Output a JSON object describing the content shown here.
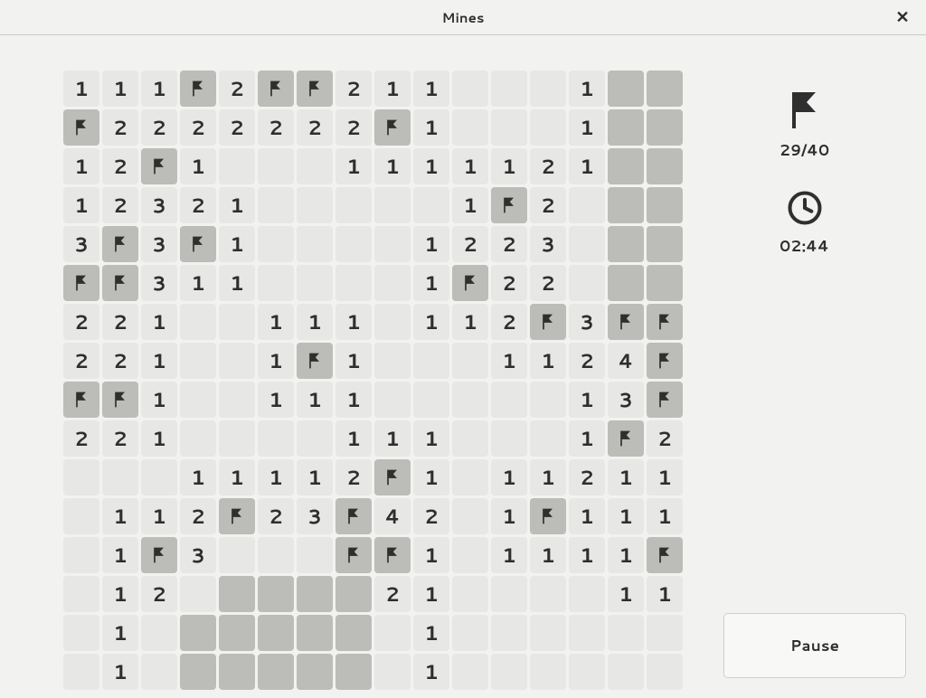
{
  "window": {
    "title": "Mines",
    "close_label": "✕"
  },
  "status": {
    "flags_placed": 29,
    "total_mines": 40,
    "flags_text": "29/40",
    "elapsed_time": "02:44"
  },
  "controls": {
    "pause_label": "Pause"
  },
  "legend": {
    ".": "revealed-empty",
    "#": "hidden",
    "F": "flagged",
    "digits": "revealed-with-number"
  },
  "board": {
    "cols": 16,
    "rows": 16,
    "grid": [
      [
        "1",
        "1",
        "1",
        "F",
        "2",
        "F",
        "F",
        "2",
        "1",
        "1",
        ".",
        ".",
        ".",
        "1",
        "#",
        "#"
      ],
      [
        "F",
        "2",
        "2",
        "2",
        "2",
        "2",
        "2",
        "2",
        "F",
        "1",
        ".",
        ".",
        ".",
        "1",
        "#",
        "#"
      ],
      [
        "1",
        "2",
        "F",
        "1",
        ".",
        ".",
        ".",
        "1",
        "1",
        "1",
        "1",
        "1",
        "2",
        "1",
        "#",
        "#"
      ],
      [
        "1",
        "2",
        "3",
        "2",
        "1",
        ".",
        ".",
        ".",
        ".",
        ".",
        "1",
        "F",
        "2",
        ".",
        "#",
        "#"
      ],
      [
        "3",
        "F",
        "3",
        "F",
        "1",
        ".",
        ".",
        ".",
        ".",
        "1",
        "2",
        "2",
        "3",
        ".",
        "#",
        "#"
      ],
      [
        "F",
        "F",
        "3",
        "1",
        "1",
        ".",
        ".",
        ".",
        ".",
        "1",
        "F",
        "2",
        "2",
        ".",
        "#",
        "#"
      ],
      [
        "2",
        "2",
        "1",
        ".",
        ".",
        "1",
        "1",
        "1",
        ".",
        "1",
        "1",
        "2",
        "F",
        "3",
        "F",
        "F"
      ],
      [
        "2",
        "2",
        "1",
        ".",
        ".",
        "1",
        "F",
        "1",
        ".",
        ".",
        ".",
        "1",
        "1",
        "2",
        "4",
        "F"
      ],
      [
        "F",
        "F",
        "1",
        ".",
        ".",
        "1",
        "1",
        "1",
        ".",
        ".",
        ".",
        ".",
        ".",
        "1",
        "3",
        "F"
      ],
      [
        "2",
        "2",
        "1",
        ".",
        ".",
        ".",
        ".",
        "1",
        "1",
        "1",
        ".",
        ".",
        ".",
        "1",
        "F",
        "2"
      ],
      [
        ".",
        ".",
        ".",
        "1",
        "1",
        "1",
        "1",
        "2",
        "F",
        "1",
        ".",
        "1",
        "1",
        "2",
        "1",
        "1"
      ],
      [
        ".",
        "1",
        "1",
        "2",
        "F",
        "2",
        "3",
        "F",
        "4",
        "2",
        ".",
        "1",
        "F",
        "1",
        "1",
        "1"
      ],
      [
        ".",
        "1",
        "F",
        "3",
        ".",
        ".",
        ".",
        "F",
        "F",
        "1",
        ".",
        "1",
        "1",
        "1",
        "1",
        "F"
      ],
      [
        ".",
        "1",
        "2",
        ".",
        "#",
        "#",
        "#",
        "#",
        "2",
        "1",
        ".",
        ".",
        ".",
        ".",
        "1",
        "1"
      ],
      [
        ".",
        "1",
        ".",
        "#",
        "#",
        "#",
        "#",
        "#",
        ".",
        "1",
        ".",
        ".",
        ".",
        ".",
        ".",
        "."
      ],
      [
        ".",
        "1",
        ".",
        "#",
        "#",
        "#",
        "#",
        "#",
        ".",
        "1",
        ".",
        ".",
        ".",
        ".",
        ".",
        "."
      ]
    ]
  }
}
